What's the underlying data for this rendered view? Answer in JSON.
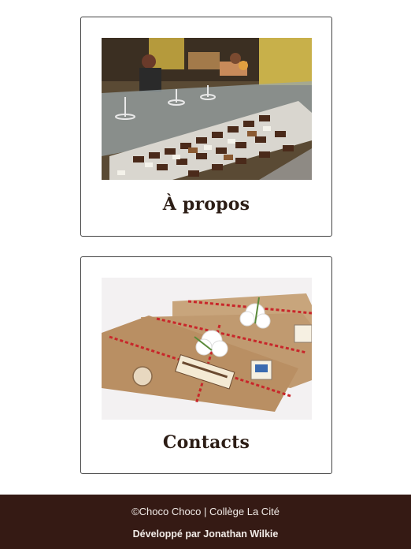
{
  "cards": [
    {
      "title": "À propos",
      "image": "chocolate-shop-display-photo"
    },
    {
      "title": "Contacts",
      "image": "wrapped-chocolate-gifts-photo"
    }
  ],
  "footer": {
    "copyright_brand": "©Choco Choco",
    "separator": " | ",
    "school": "Collège La Cité",
    "credit_prefix": "Développé par ",
    "author": "Jonathan Wilkie"
  },
  "colors": {
    "footer_bg": "#351a14",
    "title_text": "#2c1d15",
    "card_border": "#444444"
  }
}
